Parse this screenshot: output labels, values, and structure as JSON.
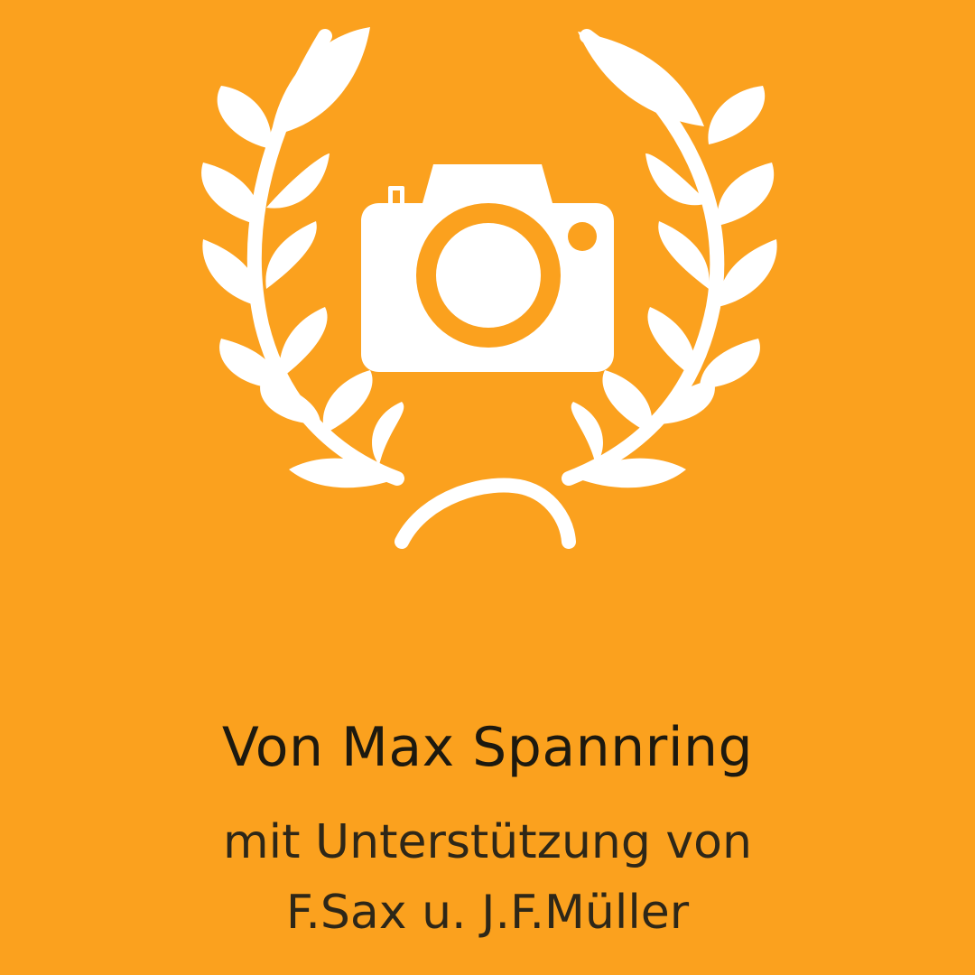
{
  "logo": {
    "icon": "camera-in-laurel-wreath-icon",
    "background_color": "#fba11e",
    "icon_color": "#ffffff"
  },
  "credits": {
    "author": "Von Max Spannring",
    "support": "mit Unterstützung von",
    "contributors": "F.Sax u. J.F.Müller"
  }
}
